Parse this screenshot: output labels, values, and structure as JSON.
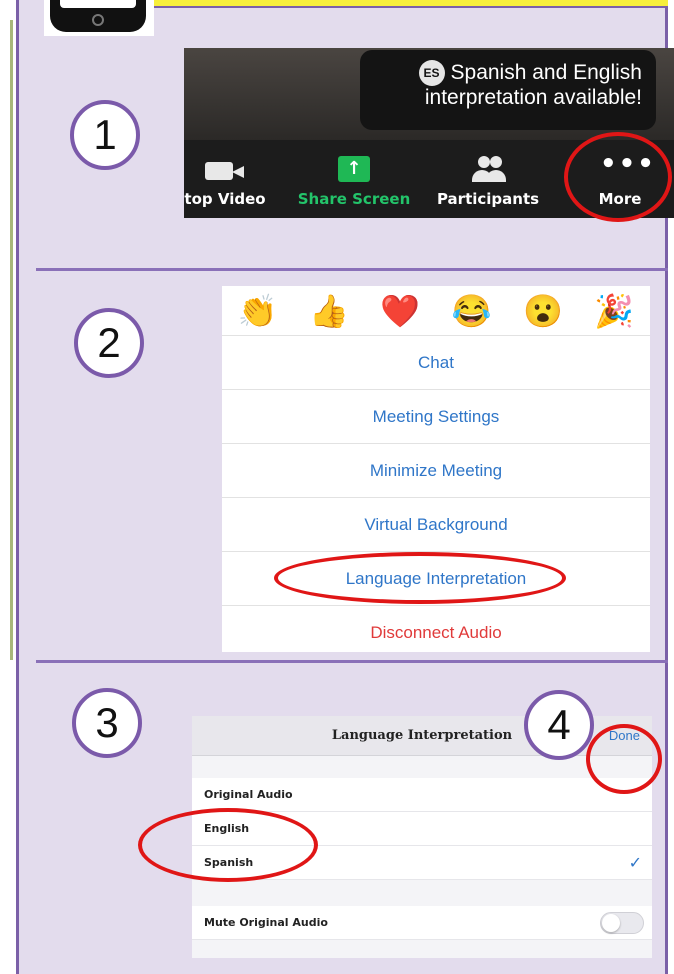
{
  "step1": {
    "number": "1",
    "tooltip": {
      "badge": "ES",
      "line1": "Spanish and English",
      "line2": "interpretation available!"
    },
    "buttons": [
      {
        "label": "top Video",
        "icon": "video-camera-icon"
      },
      {
        "label": "Share Screen",
        "icon": "share-screen-icon"
      },
      {
        "label": "Participants",
        "icon": "participants-icon"
      },
      {
        "label": "More",
        "icon": "more-dots-icon"
      }
    ]
  },
  "step2": {
    "number": "2",
    "reactions": [
      "👏",
      "👍",
      "❤️",
      "😂",
      "😮",
      "🎉"
    ],
    "menu": [
      "Chat",
      "Meeting Settings",
      "Minimize Meeting",
      "Virtual Background",
      "Language Interpretation",
      "Disconnect Audio"
    ]
  },
  "step3": {
    "number": "3",
    "title": "Language Interpretation",
    "done": "Done",
    "options": [
      "Original Audio",
      "English",
      "Spanish"
    ],
    "selected": "Spanish",
    "mute_label": "Mute Original Audio",
    "mute_on": false
  },
  "step4": {
    "number": "4"
  },
  "colors": {
    "panel": "#e3dced",
    "border": "#7b60a8",
    "highlight": "#e01616",
    "link": "#2f76c8",
    "share_green": "#1fb855",
    "danger": "#e03a3a"
  }
}
